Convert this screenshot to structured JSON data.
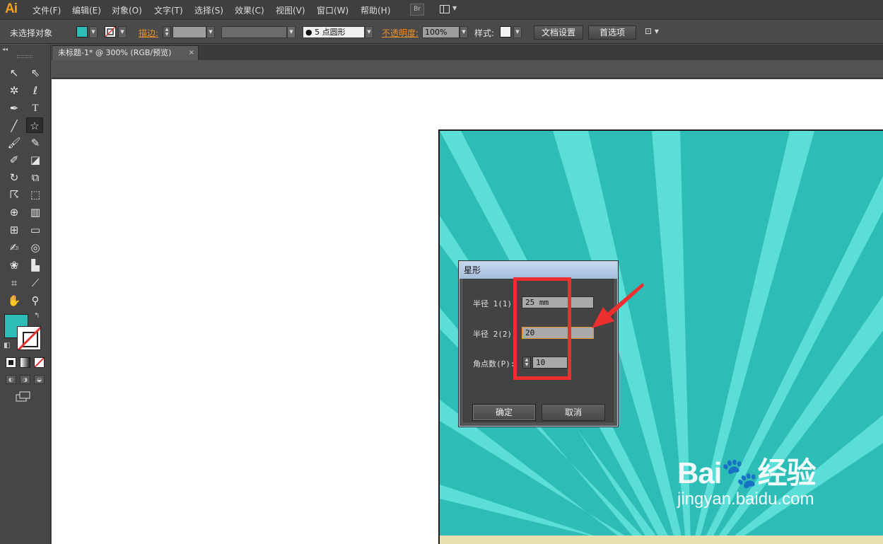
{
  "app": {
    "logo": "Ai"
  },
  "menu": [
    {
      "label": "文件(F)"
    },
    {
      "label": "编辑(E)"
    },
    {
      "label": "对象(O)"
    },
    {
      "label": "文字(T)"
    },
    {
      "label": "选择(S)"
    },
    {
      "label": "效果(C)"
    },
    {
      "label": "视图(V)"
    },
    {
      "label": "窗口(W)"
    },
    {
      "label": "帮助(H)"
    }
  ],
  "menu_extras": {
    "bridge": "Br"
  },
  "control_bar": {
    "selection_status": "未选择对象",
    "fill_color": "#2ebdb6",
    "stroke_link": "描边:",
    "brush_value": "5 点圆形",
    "opacity_link": "不透明度:",
    "opacity_value": "100%",
    "style_label": "样式:",
    "doc_setup_button": "文档设置",
    "preferences_button": "首选项"
  },
  "document_tab": {
    "title": "未标题-1* @ 300% (RGB/预览)",
    "close": "×"
  },
  "tools": [
    "selection-tool",
    "direct-selection-tool",
    "magic-wand-tool",
    "lasso-tool",
    "pen-tool",
    "type-tool",
    "line-tool",
    "star-tool",
    "paintbrush-tool",
    "pencil-tool",
    "blob-brush-tool",
    "eraser-tool",
    "rotate-tool",
    "scale-tool",
    "warp-tool",
    "free-transform-tool",
    "shape-builder-tool",
    "perspective-grid-tool",
    "mesh-tool",
    "gradient-tool",
    "eyedropper-tool",
    "blend-tool",
    "symbol-sprayer-tool",
    "column-graph-tool",
    "artboard-tool",
    "slice-tool",
    "hand-tool",
    "zoom-tool"
  ],
  "toolbox": {
    "fill_color": "#2ebdb6",
    "active_tool": "star-tool"
  },
  "artboard": {
    "background": "#2ebdb6",
    "ray_color": "#5cded8",
    "ground_color": "#e8e0b0"
  },
  "dialog": {
    "title": "星形",
    "radius1_label": "半径 1(1):",
    "radius1_value": "25 mm",
    "radius2_label": "半径 2(2):",
    "radius2_value": "20",
    "points_label": "角点数(P):",
    "points_value": "10",
    "ok_button": "确定",
    "cancel_button": "取消"
  },
  "annotation": {
    "color": "#ee2f2f"
  },
  "watermark": {
    "brand": "Bai",
    "brand_suffix": "经验",
    "url": "jingyan.baidu.com"
  }
}
